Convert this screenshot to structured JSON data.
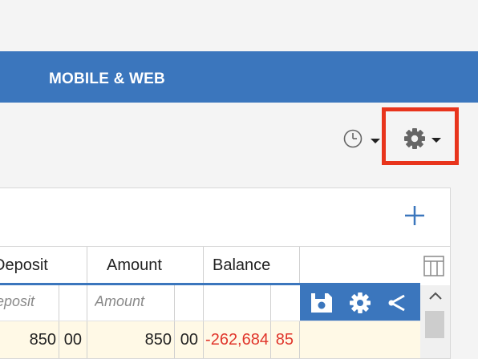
{
  "nav": {
    "title": "MOBILE & WEB"
  },
  "toolbar": {
    "history_icon": "clock-icon",
    "settings_icon": "gear-icon",
    "highlight_color": "#e8341c"
  },
  "panel": {
    "add_icon": "plus-icon",
    "columns": {
      "deposit": "Deposit",
      "amount": "Amount",
      "balance": "Balance"
    },
    "filters": {
      "deposit_placeholder": "Deposit",
      "amount_placeholder": "Amount"
    },
    "row_actions": [
      "save-icon",
      "gear-icon",
      "share-icon"
    ],
    "rows": [
      {
        "deposit_int": "850",
        "deposit_dec": "00",
        "amount_int": "850",
        "amount_dec": "00",
        "balance_int": "-262,684",
        "balance_dec": "85"
      }
    ]
  },
  "colors": {
    "brand": "#3b76bd",
    "negative": "#e0342a",
    "row_highlight": "#fff9e6"
  }
}
